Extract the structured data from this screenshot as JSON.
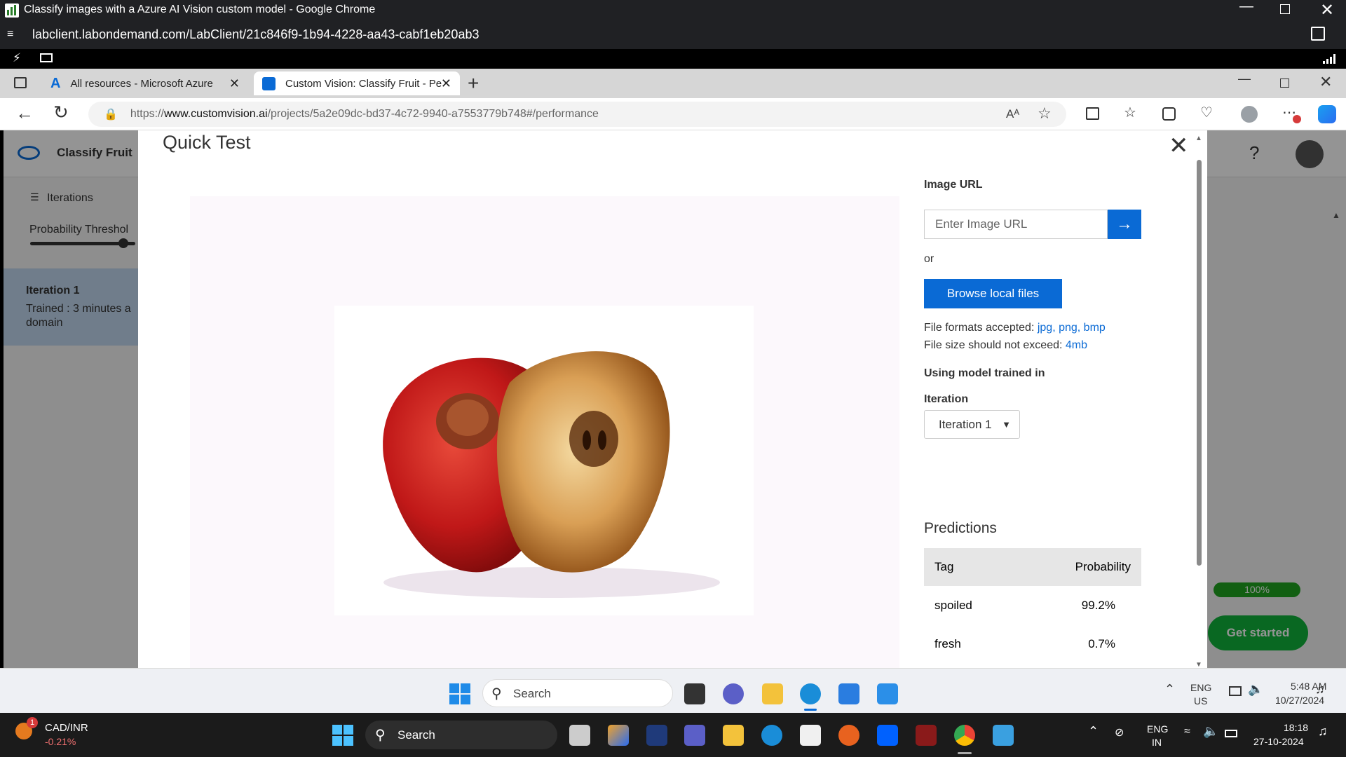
{
  "outer_window": {
    "title": "Classify images with a Azure AI Vision custom model - Google Chrome",
    "url": "labclient.labondemand.com/LabClient/21c846f9-1b94-4228-aa43-cabf1eb20ab3"
  },
  "edge": {
    "tabs": [
      {
        "label": "All resources - Microsoft Azure"
      },
      {
        "label": "Custom Vision: Classify Fruit - Pe"
      }
    ],
    "url_prefix": "https://",
    "url_host": "www.customvision.ai",
    "url_path": "/projects/5a2e09dc-bd37-4c72-9940-a7553779b748#/performance",
    "read_aloud_label": "Aᴬ"
  },
  "background_page": {
    "project_name": "Classify Fruit",
    "iterations_label": "Iterations",
    "threshold_label": "Probability Threshol",
    "iteration_title": "Iteration 1",
    "trained_text": "Trained : 3 minutes a",
    "domain_text": "domain",
    "help_label": "?",
    "progress_label": "100%",
    "get_started_label": "Get started"
  },
  "modal": {
    "title": "Quick Test",
    "image_url_label": "Image URL",
    "image_url_placeholder": "Enter Image URL",
    "or_label": "or",
    "browse_label": "Browse local files",
    "formats_prefix": "File formats accepted: ",
    "formats": "jpg, png, bmp",
    "size_prefix": "File size should not exceed: ",
    "size": "4mb",
    "model_label": "Using model trained in",
    "iteration_label": "Iteration",
    "iteration_value": "Iteration 1",
    "predictions_title": "Predictions",
    "table_headers": {
      "tag": "Tag",
      "probability": "Probability"
    },
    "predictions": [
      {
        "tag": "spoiled",
        "probability": "99.2%"
      },
      {
        "tag": "fresh",
        "probability": "0.7%"
      }
    ]
  },
  "inner_taskbar": {
    "search_label": "Search",
    "lang": "ENG",
    "region": "US",
    "time": "5:48 AM",
    "date": "10/27/2024"
  },
  "outer_taskbar": {
    "ticker_name": "CAD/INR",
    "ticker_change": "-0.21%",
    "ticker_badge": "1",
    "search_label": "Search",
    "lang": "ENG",
    "region": "IN",
    "time": "18:18",
    "date": "27-10-2024"
  },
  "colors": {
    "accent": "#0a6ad5",
    "progress_green": "#1fa41f",
    "get_started_green": "#10b33b"
  }
}
